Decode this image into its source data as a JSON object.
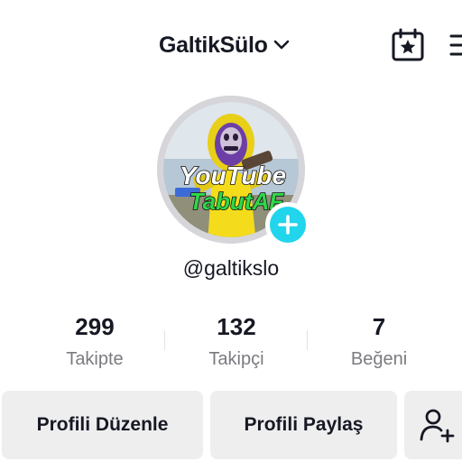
{
  "header": {
    "username": "GaltikSülo",
    "icons": {
      "dropdown": "chevron-down-icon",
      "calendar": "calendar-star-icon",
      "menu": "hamburger-menu-icon"
    }
  },
  "profile": {
    "handle": "@galtikslo",
    "avatar_text_line1": "YouTube",
    "avatar_text_line2": "TabutAF",
    "add_icon": "plus-icon"
  },
  "stats": [
    {
      "value": "299",
      "label": "Takipte"
    },
    {
      "value": "132",
      "label": "Takipçi"
    },
    {
      "value": "7",
      "label": "Beğeni"
    }
  ],
  "actions": {
    "edit_profile": "Profili Düzenle",
    "share_profile": "Profili Paylaş",
    "add_friends_icon": "add-user-icon"
  },
  "colors": {
    "accent": "#20d5ec",
    "text_primary": "#161823",
    "text_secondary": "#7a7b80",
    "button_bg": "#eeeeef"
  }
}
